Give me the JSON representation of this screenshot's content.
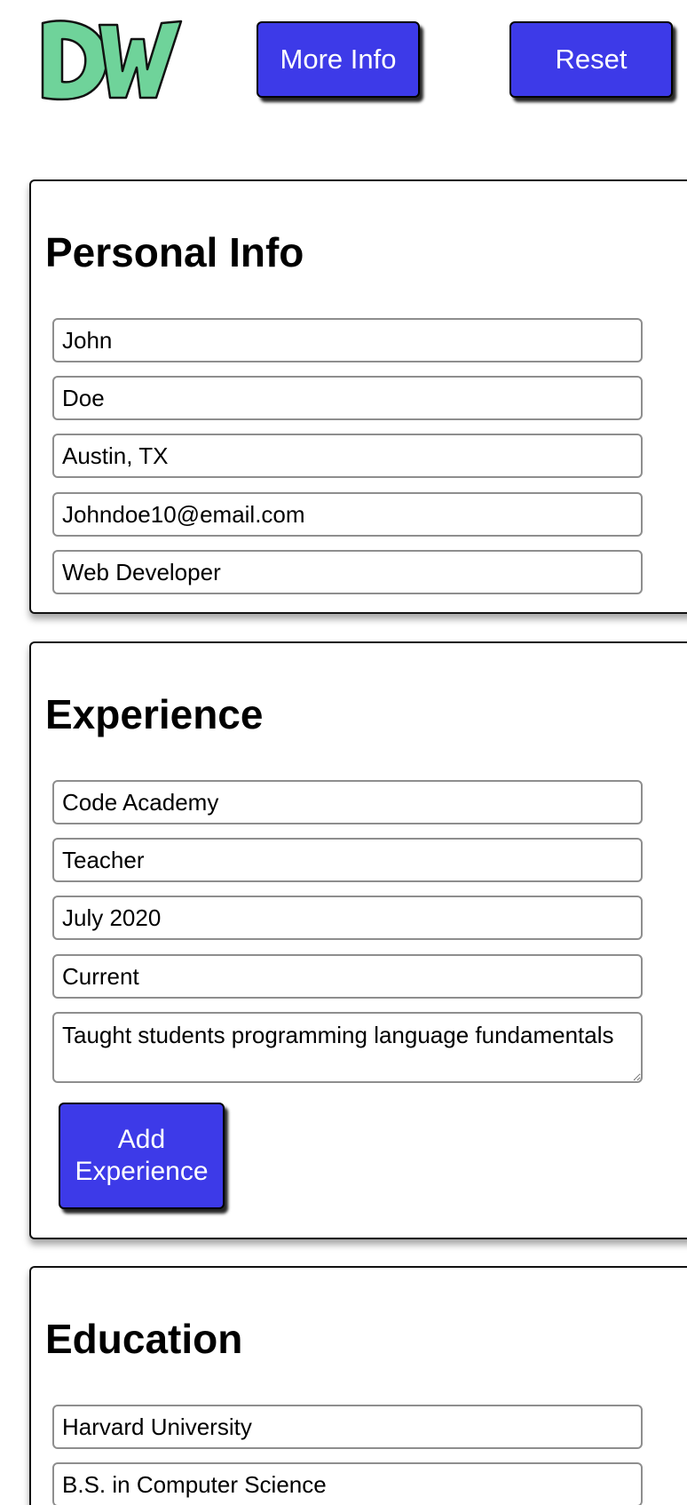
{
  "header": {
    "logo_text": "DW",
    "more_info_label": "More Info",
    "reset_label": "Reset"
  },
  "colors": {
    "button_bg": "#3d3ae8",
    "logo_fill": "#6fd39a"
  },
  "personal": {
    "title": "Personal Info",
    "first_name": "John",
    "last_name": "Doe",
    "location": "Austin, TX",
    "email": "Johndoe10@email.com",
    "job_title": "Web Developer"
  },
  "experience": {
    "title": "Experience",
    "company": "Code Academy",
    "position": "Teacher",
    "start": "July 2020",
    "end": "Current",
    "description": "Taught students programming language fundamentals",
    "add_button_line1": "Add",
    "add_button_line2": "Experience"
  },
  "education": {
    "title": "Education",
    "school": "Harvard University",
    "degree": "B.S. in Computer Science"
  }
}
